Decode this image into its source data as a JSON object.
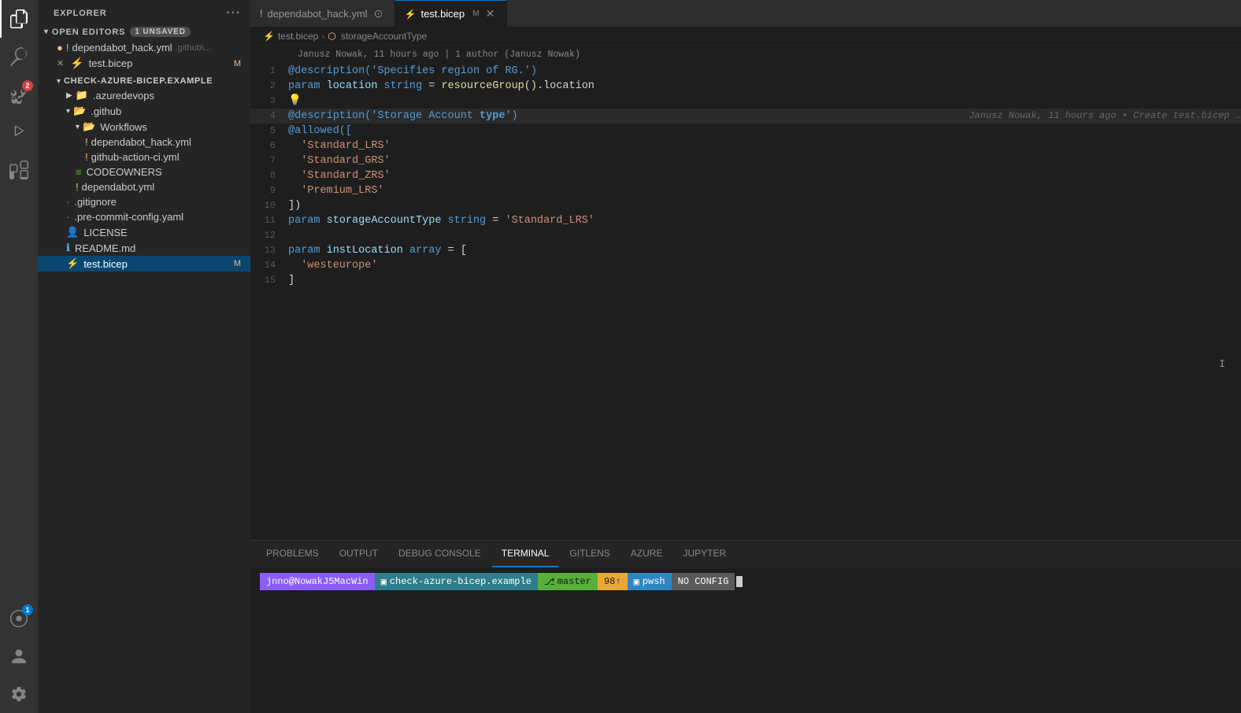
{
  "activityBar": {
    "icons": [
      {
        "name": "explorer-icon",
        "symbol": "⬜",
        "active": true,
        "badge": null
      },
      {
        "name": "search-icon",
        "symbol": "🔍",
        "active": false,
        "badge": null
      },
      {
        "name": "source-control-icon",
        "symbol": "⑂",
        "active": false,
        "badge": "2"
      },
      {
        "name": "run-icon",
        "symbol": "▷",
        "active": false,
        "badge": null
      },
      {
        "name": "extensions-icon",
        "symbol": "⊞",
        "active": false,
        "badge": null
      },
      {
        "name": "remote-icon",
        "symbol": "◎",
        "active": false,
        "badge": "1"
      }
    ],
    "bottomIcons": [
      {
        "name": "account-icon",
        "symbol": "👤"
      },
      {
        "name": "settings-icon",
        "symbol": "⚙"
      }
    ]
  },
  "sidebar": {
    "title": "EXPLORER",
    "openEditors": {
      "label": "OPEN EDITORS",
      "unsaved": "1 unsaved",
      "items": [
        {
          "icon": "!",
          "filename": "dependabot_hack.yml",
          "path": ".github\\...",
          "dot": true,
          "warning": true
        },
        {
          "icon": "⚡",
          "filename": "test.bicep",
          "badge": "M",
          "active": false,
          "close": true
        }
      ]
    },
    "project": {
      "name": "CHECK-AZURE-BICEP.EXAMPLE",
      "items": [
        {
          "label": ".azuredevops",
          "indent": 1,
          "type": "folder",
          "collapsed": true
        },
        {
          "label": ".github",
          "indent": 1,
          "type": "folder",
          "collapsed": false
        },
        {
          "label": "Workflows",
          "indent": 2,
          "type": "folder",
          "collapsed": false
        },
        {
          "label": "dependabot_hack.yml",
          "indent": 3,
          "type": "file-warning"
        },
        {
          "label": "github-action-ci.yml",
          "indent": 3,
          "type": "file-warning"
        },
        {
          "label": "CODEOWNERS",
          "indent": 2,
          "type": "file-special"
        },
        {
          "label": "dependabot.yml",
          "indent": 2,
          "type": "file-warning"
        },
        {
          "label": ".gitignore",
          "indent": 1,
          "type": "file"
        },
        {
          "label": ".pre-commit-config.yaml",
          "indent": 1,
          "type": "file"
        },
        {
          "label": "LICENSE",
          "indent": 1,
          "type": "file-license"
        },
        {
          "label": "README.md",
          "indent": 1,
          "type": "file-info"
        },
        {
          "label": "test.bicep",
          "indent": 1,
          "type": "file-bicep",
          "badge": "M"
        }
      ]
    }
  },
  "tabs": [
    {
      "label": "dependabot_hack.yml",
      "icon": "!",
      "active": false,
      "modified": false,
      "dot": true,
      "warning": true
    },
    {
      "label": "test.bicep",
      "icon": "⚡",
      "active": true,
      "modified": false,
      "close": true
    }
  ],
  "breadcrumb": {
    "file": "test.bicep",
    "symbol": "storageAccountType"
  },
  "gitBlame": "Janusz Nowak, 11 hours ago | 1 author (Janusz Nowak)",
  "code": {
    "lines": [
      {
        "num": 1,
        "tokens": [
          {
            "t": "@description('Specifies region of RG.')",
            "c": "dec"
          }
        ]
      },
      {
        "num": 2,
        "tokens": [
          {
            "t": "param ",
            "c": "kw"
          },
          {
            "t": "location",
            "c": "var"
          },
          {
            "t": " string",
            "c": "kw"
          },
          {
            "t": " = ",
            "c": "op"
          },
          {
            "t": "resourceGroup()",
            "c": "fn"
          },
          {
            "t": ".location",
            "c": "op"
          }
        ]
      },
      {
        "num": 3,
        "tokens": [],
        "bulb": true
      },
      {
        "num": 4,
        "tokens": [
          {
            "t": "@description('Storage Account type')",
            "c": "dec"
          }
        ],
        "annotation": "Janusz Nowak, 11 hours ago • Create test.bicep …",
        "highlighted": true
      },
      {
        "num": 5,
        "tokens": [
          {
            "t": "@allowed([",
            "c": "dec"
          }
        ]
      },
      {
        "num": 6,
        "tokens": [
          {
            "t": "  'Standard_LRS'",
            "c": "str"
          }
        ]
      },
      {
        "num": 7,
        "tokens": [
          {
            "t": "  'Standard_GRS'",
            "c": "str"
          }
        ]
      },
      {
        "num": 8,
        "tokens": [
          {
            "t": "  'Standard_ZRS'",
            "c": "str"
          }
        ]
      },
      {
        "num": 9,
        "tokens": [
          {
            "t": "  'Premium_LRS'",
            "c": "str"
          }
        ]
      },
      {
        "num": 10,
        "tokens": [
          {
            "t": "])",
            "c": "punc"
          }
        ]
      },
      {
        "num": 11,
        "tokens": [
          {
            "t": "param ",
            "c": "kw"
          },
          {
            "t": "storageAccountType",
            "c": "var"
          },
          {
            "t": " string",
            "c": "kw"
          },
          {
            "t": " = ",
            "c": "op"
          },
          {
            "t": "'Standard_LRS'",
            "c": "str"
          }
        ]
      },
      {
        "num": 12,
        "tokens": []
      },
      {
        "num": 13,
        "tokens": [
          {
            "t": "param ",
            "c": "kw"
          },
          {
            "t": "instLocation",
            "c": "var"
          },
          {
            "t": " array",
            "c": "kw"
          },
          {
            "t": " = [",
            "c": "op"
          }
        ]
      },
      {
        "num": 14,
        "tokens": [
          {
            "t": "  'westeurope'",
            "c": "str"
          }
        ]
      },
      {
        "num": 15,
        "tokens": [
          {
            "t": "]",
            "c": "punc"
          }
        ]
      }
    ]
  },
  "panel": {
    "tabs": [
      "PROBLEMS",
      "OUTPUT",
      "DEBUG CONSOLE",
      "TERMINAL",
      "GITLENS",
      "AZURE",
      "JUPYTER"
    ],
    "activeTab": "TERMINAL",
    "terminal": {
      "segments": [
        {
          "label": "jnno@NowakJ5MacWin",
          "cls": "seg-user"
        },
        {
          "label": "◣",
          "cls": "seg-arrow1"
        },
        {
          "icon": "▣",
          "label": " check-azure-bicep.example",
          "cls": "seg-dir"
        },
        {
          "label": "◣",
          "cls": "seg-arrow2"
        },
        {
          "icon": "⎇",
          "label": " master",
          "cls": "seg-branch"
        },
        {
          "label": "◣",
          "cls": "seg-arrow3"
        },
        {
          "label": "98↑",
          "cls": "seg-num"
        },
        {
          "label": "◣",
          "cls": "seg-arrow4"
        },
        {
          "icon": "▣",
          "label": " pwsh",
          "cls": "seg-pwsh"
        },
        {
          "label": "◣",
          "cls": "seg-arrow5"
        },
        {
          "label": "NO CONFIG",
          "cls": "seg-noconfig"
        },
        {
          "label": "◣",
          "cls": "seg-arrow6"
        }
      ]
    }
  }
}
